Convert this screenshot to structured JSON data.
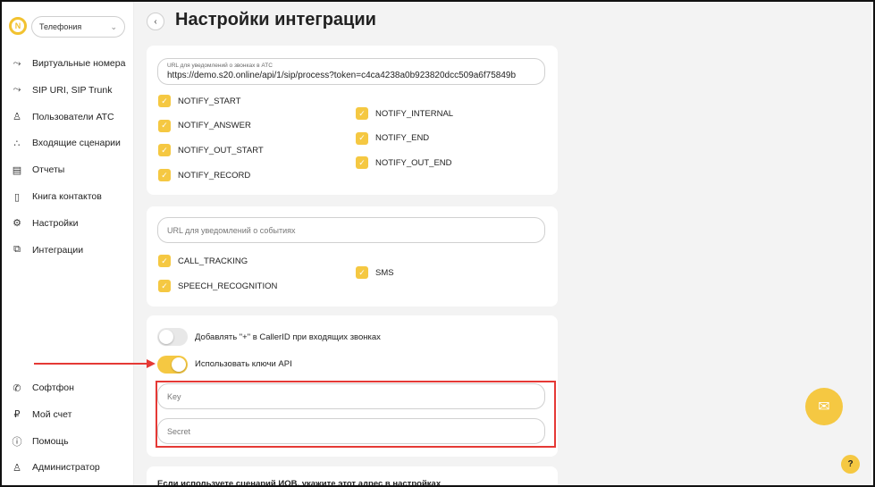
{
  "sidebar": {
    "select_value": "Телефония",
    "nav_top": [
      {
        "label": "Виртуальные номера",
        "icon": "phone-routing-icon",
        "glyph": "⤳"
      },
      {
        "label": "SIP URI, SIP Trunk",
        "icon": "sip-icon",
        "glyph": "⤳"
      },
      {
        "label": "Пользователи АТС",
        "icon": "user-icon",
        "glyph": "♙"
      },
      {
        "label": "Входящие сценарии",
        "icon": "scenario-icon",
        "glyph": "∴"
      },
      {
        "label": "Отчеты",
        "icon": "report-icon",
        "glyph": "▤"
      },
      {
        "label": "Книга контактов",
        "icon": "contacts-book-icon",
        "glyph": "▯"
      },
      {
        "label": "Настройки",
        "icon": "gear-icon",
        "glyph": "⚙"
      },
      {
        "label": "Интеграции",
        "icon": "integrations-icon",
        "glyph": "⧉"
      }
    ],
    "nav_bottom": [
      {
        "label": "Софтфон",
        "icon": "phone-icon",
        "glyph": "✆"
      },
      {
        "label": "Мой счет",
        "icon": "wallet-icon",
        "glyph": "₽"
      },
      {
        "label": "Помощь",
        "icon": "help-icon",
        "glyph": "ⓘ"
      },
      {
        "label": "Администратор",
        "icon": "admin-icon",
        "glyph": "♙"
      }
    ]
  },
  "main": {
    "title": "Настройки интеграции",
    "card1": {
      "url_label": "URL для уведомлений о звонках в АТС",
      "url_value": "https://demo.s20.online/api/1/sip/process?token=c4ca4238a0b923820dcc509a6f75849b",
      "left_checks": [
        "NOTIFY_START",
        "NOTIFY_ANSWER",
        "NOTIFY_OUT_START",
        "NOTIFY_RECORD"
      ],
      "right_checks": [
        "NOTIFY_INTERNAL",
        "NOTIFY_END",
        "NOTIFY_OUT_END"
      ]
    },
    "card2": {
      "url_placeholder": "URL для уведомлений о событиях",
      "left_checks": [
        "CALL_TRACKING",
        "SPEECH_RECOGNITION"
      ],
      "right_checks": [
        "SMS"
      ]
    },
    "card3": {
      "toggle_callerid_label": "Добавлять \"+\" в CallerID при входящих звонках",
      "toggle_callerid_on": false,
      "toggle_api_label": "Использовать ключи API",
      "toggle_api_on": true,
      "key_placeholder": "Key",
      "secret_placeholder": "Secret"
    },
    "card4": {
      "text": "Если используете сценарий ИОВ, укажите этот адрес в настройках"
    }
  },
  "colors": {
    "accent": "#f5c842",
    "annotation": "#e53935",
    "background": "#f3f3f3"
  }
}
